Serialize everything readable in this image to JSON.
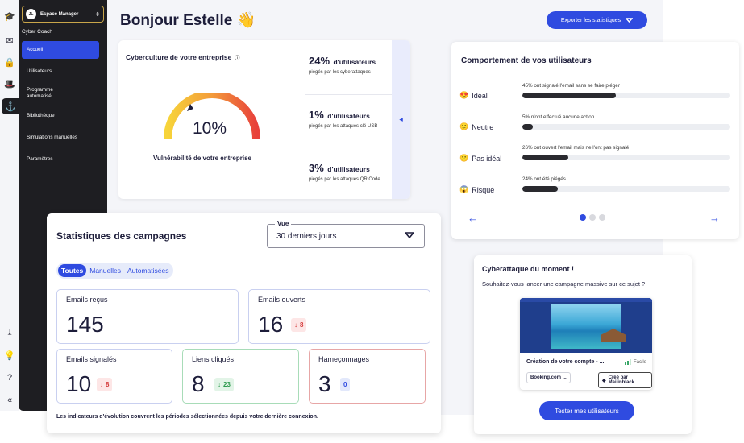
{
  "space_selector": {
    "badge": "JL",
    "name": "Espace Manager"
  },
  "brand": "Cyber Coach",
  "sidebar": {
    "items": [
      {
        "label": "Accueil",
        "active": true
      },
      {
        "label": "Utilisateurs"
      },
      {
        "label": "Programme automatisé"
      },
      {
        "label": "Bibliothèque"
      },
      {
        "label": "Simulations manuelles"
      },
      {
        "label": "Paramètres"
      }
    ]
  },
  "rail_icons": [
    "graduation-cap-icon",
    "mail-icon",
    "lock-icon",
    "hat-icon",
    "hook-icon",
    "download-icon",
    "lightbulb-icon",
    "help-icon",
    "collapse-icon"
  ],
  "header": {
    "title": "Bonjour Estelle",
    "emoji": "👋",
    "export_label": "Exporter les statistiques"
  },
  "cyberculture": {
    "title": "Cyberculture de votre entreprise",
    "info_icon": "ⓘ",
    "gauge_value": "10%",
    "gauge_level": 0.1,
    "label": "Vulnérabilité de votre entreprise",
    "stats": [
      {
        "value": "24%",
        "unit": "d'utilisateurs",
        "desc": "piégés par les cyberattaques"
      },
      {
        "value": "1%",
        "unit": "d'utilisateurs",
        "desc": "piégés par les attaques clé USB"
      },
      {
        "value": "3%",
        "unit": "d'utilisateurs",
        "desc": "piégés par les attaques QR Code"
      }
    ]
  },
  "behaviour": {
    "title": "Comportement de vos utilisateurs",
    "rows": [
      {
        "emoji": "😍",
        "label": "Idéal",
        "caption": "45% ont signalé l'email sans se faire piéger",
        "level": 0.45
      },
      {
        "emoji": "🙂",
        "label": "Neutre",
        "caption": "5% n'ont effectué aucune action",
        "level": 0.05
      },
      {
        "emoji": "😕",
        "label": "Pas idéal",
        "caption": "26% ont ouvert l'email mais ne l'ont pas signalé",
        "level": 0.22
      },
      {
        "emoji": "😱",
        "label": "Risqué",
        "caption": "24% ont été piégés",
        "level": 0.17
      }
    ],
    "pager": {
      "pages": 3,
      "current": 1
    }
  },
  "campaigns": {
    "title": "Statistiques des campagnes",
    "view_label": "Vue",
    "view_value": "30 derniers jours",
    "filters": [
      {
        "label": "Toutes",
        "active": true
      },
      {
        "label": "Manuelles"
      },
      {
        "label": "Automatisées"
      }
    ],
    "kpis": {
      "recus": {
        "label": "Emails reçus",
        "value": "145"
      },
      "ouverts": {
        "label": "Emails ouverts",
        "value": "16",
        "delta": "8"
      },
      "signales": {
        "label": "Emails signalés",
        "value": "10",
        "delta": "8"
      },
      "liens": {
        "label": "Liens cliqués",
        "value": "8",
        "delta": "23"
      },
      "hamecon": {
        "label": "Hameçonnages",
        "value": "3",
        "delta": "0"
      }
    },
    "footnote": "Les indicateurs d'évolution couvrent les périodes sélectionnées depuis votre dernière connexion."
  },
  "attack": {
    "title": "Cyberattaque du moment !",
    "question": "Souhaitez-vous lancer une campagne massive sur ce sujet ?",
    "template": {
      "name": "Création de votre compte - ...",
      "difficulty": "Facile",
      "sender": "Booking.com ...",
      "creator": "Créé par Mailinblack"
    },
    "button": "Tester mes utilisateurs"
  },
  "colors": {
    "primary": "#2f4be0",
    "sidebar": "#1e1e22",
    "danger": "#d43a3a",
    "success": "#2e9a4f"
  }
}
